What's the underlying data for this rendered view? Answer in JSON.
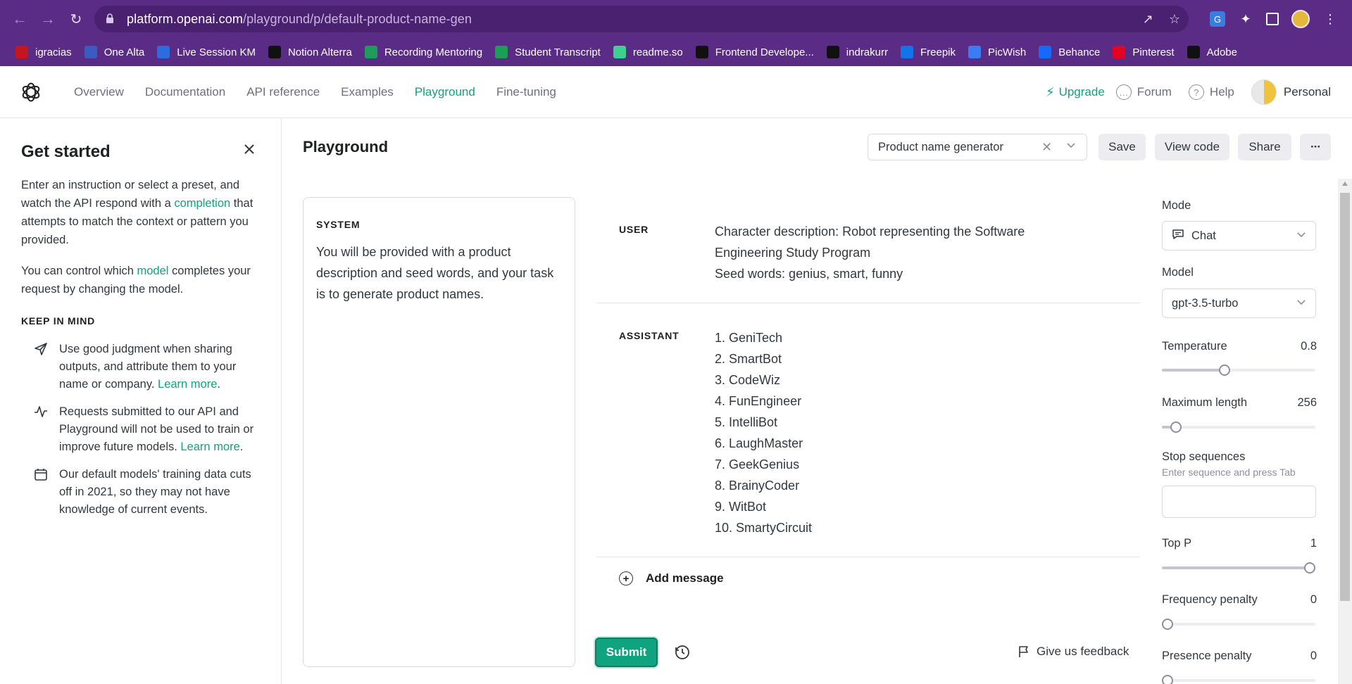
{
  "browser": {
    "url_host": "platform.openai.com",
    "url_path": "/playground/p/default-product-name-gen",
    "bookmarks": [
      {
        "label": "igracias",
        "icon": "igracias-icon",
        "color": "#c4161c"
      },
      {
        "label": "One Alta",
        "icon": "one-alta-icon",
        "color": "#3a5bbf"
      },
      {
        "label": "Live Session KM",
        "icon": "zoom-icon",
        "color": "#2d6cdf"
      },
      {
        "label": "Notion Alterra",
        "icon": "notion-icon",
        "color": "#111111"
      },
      {
        "label": "Recording Mentoring",
        "icon": "sheets-icon",
        "color": "#1e9d58"
      },
      {
        "label": "Student Transcript",
        "icon": "sheets-icon",
        "color": "#1e9d58"
      },
      {
        "label": "readme.so",
        "icon": "readme-icon",
        "color": "#3fcf8e"
      },
      {
        "label": "Frontend Develope...",
        "icon": "frontend-icon",
        "color": "#111111"
      },
      {
        "label": "indrakurr",
        "icon": "github-icon",
        "color": "#111111"
      },
      {
        "label": "Freepik",
        "icon": "freepik-icon",
        "color": "#1273eb"
      },
      {
        "label": "PicWish",
        "icon": "picwish-icon",
        "color": "#3b7bf6"
      },
      {
        "label": "Behance",
        "icon": "behance-icon",
        "color": "#1769ff"
      },
      {
        "label": "Pinterest",
        "icon": "pinterest-icon",
        "color": "#e60023"
      },
      {
        "label": "Adobe",
        "icon": "adobe-icon",
        "color": "#111111"
      }
    ]
  },
  "header": {
    "nav": [
      "Overview",
      "Documentation",
      "API reference",
      "Examples",
      "Playground",
      "Fine-tuning"
    ],
    "active_nav": "Playground",
    "upgrade": "Upgrade",
    "forum": "Forum",
    "help": "Help",
    "account": "Personal",
    "accent_color": "#10a37f"
  },
  "sidebar": {
    "title": "Get started",
    "p1_a": "Enter an instruction or select a preset, and watch the API respond with a ",
    "p1_link": "completion",
    "p1_b": " that attempts to match the context or pattern you provided.",
    "p2_a": "You can control which ",
    "p2_link": "model",
    "p2_b": " completes your request by changing the model.",
    "keep_in_mind": "KEEP IN MIND",
    "tip1_text": "Use good judgment when sharing outputs, and attribute them to your name or company. ",
    "tip1_link": "Learn more",
    "tip1_end": ".",
    "tip2_text": "Requests submitted to our API and Playground will not be used to train or improve future models. ",
    "tip2_link": "Learn more",
    "tip2_end": ".",
    "tip3_text": "Our default models' training data cuts off in 2021, so they may not have knowledge of current events."
  },
  "main": {
    "title": "Playground",
    "preset": "Product name generator",
    "save": "Save",
    "view_code": "View code",
    "share": "Share",
    "more": "···",
    "system_label": "SYSTEM",
    "system_text": "You will be provided with a product description and seed words, and your task is to generate product names.",
    "user_label": "USER",
    "user_lines": [
      "Character description: Robot representing the Software",
      "Engineering Study Program",
      "Seed words: genius, smart, funny"
    ],
    "assistant_label": "ASSISTANT",
    "assistant_lines": [
      "1. GeniTech",
      "2. SmartBot",
      "3. CodeWiz",
      "4. FunEngineer",
      "5. IntelliBot",
      "6. LaughMaster",
      "7. GeekGenius",
      "8. BrainyCoder",
      "9. WitBot",
      "10. SmartyCircuit"
    ],
    "add_message": "Add message",
    "submit": "Submit",
    "feedback": "Give us feedback"
  },
  "settings": {
    "mode_label": "Mode",
    "mode_value": "Chat",
    "model_label": "Model",
    "model_value": "gpt-3.5-turbo",
    "temperature_label": "Temperature",
    "temperature": "0.8",
    "temperature_frac": 0.4,
    "max_length_label": "Maximum length",
    "max_length": "256",
    "max_length_frac": 0.06,
    "stop_label": "Stop sequences",
    "stop_hint": "Enter sequence and press Tab",
    "top_p_label": "Top P",
    "top_p": "1",
    "top_p_frac": 1.0,
    "freq_label": "Frequency penalty",
    "freq": "0",
    "freq_frac": 0.0,
    "presence_label": "Presence penalty",
    "presence": "0",
    "presence_frac": 0.0
  }
}
